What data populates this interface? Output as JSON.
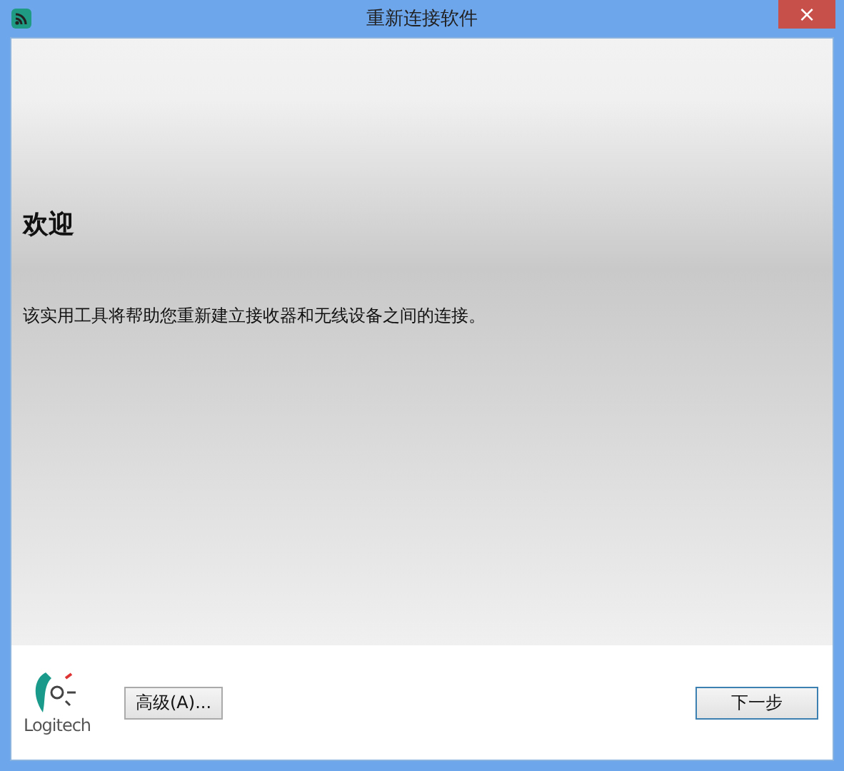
{
  "window": {
    "title": "重新连接软件",
    "close": "×"
  },
  "content": {
    "heading": "欢迎",
    "text": "该实用工具将帮助您重新建立接收器和无线设备之间的连接。"
  },
  "footer": {
    "logo_text": "Logitech",
    "buttons": [
      {
        "label": "高级(A)...",
        "kind": "secondary",
        "focused": false
      },
      {
        "label": "下一步",
        "kind": "primary",
        "focused": true
      }
    ]
  }
}
